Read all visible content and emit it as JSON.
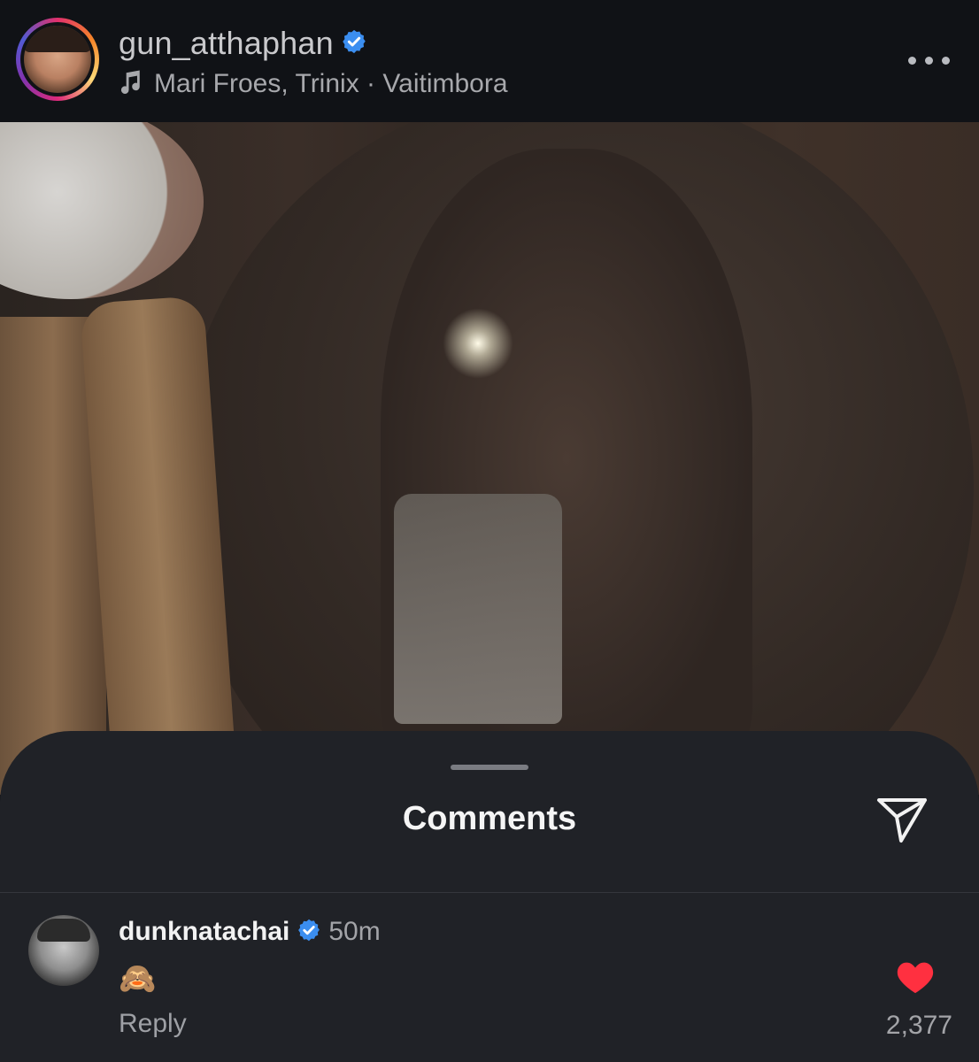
{
  "post": {
    "username": "gun_atthaphan",
    "verified": true,
    "music": "Mari Froes, Trinix · Vaitimbora",
    "more_icon": "more-horizontal-icon"
  },
  "comments_sheet": {
    "title": "Comments",
    "share_icon": "send-icon",
    "comments": [
      {
        "author": "dunknatachai",
        "verified": true,
        "time": "50m",
        "text": "🙈",
        "reply_label": "Reply",
        "like_count": "2,377",
        "liked": true
      }
    ]
  },
  "colors": {
    "verified_blue": "#3b8ef0",
    "like_red": "#ff3040",
    "sheet_bg": "#202227"
  }
}
